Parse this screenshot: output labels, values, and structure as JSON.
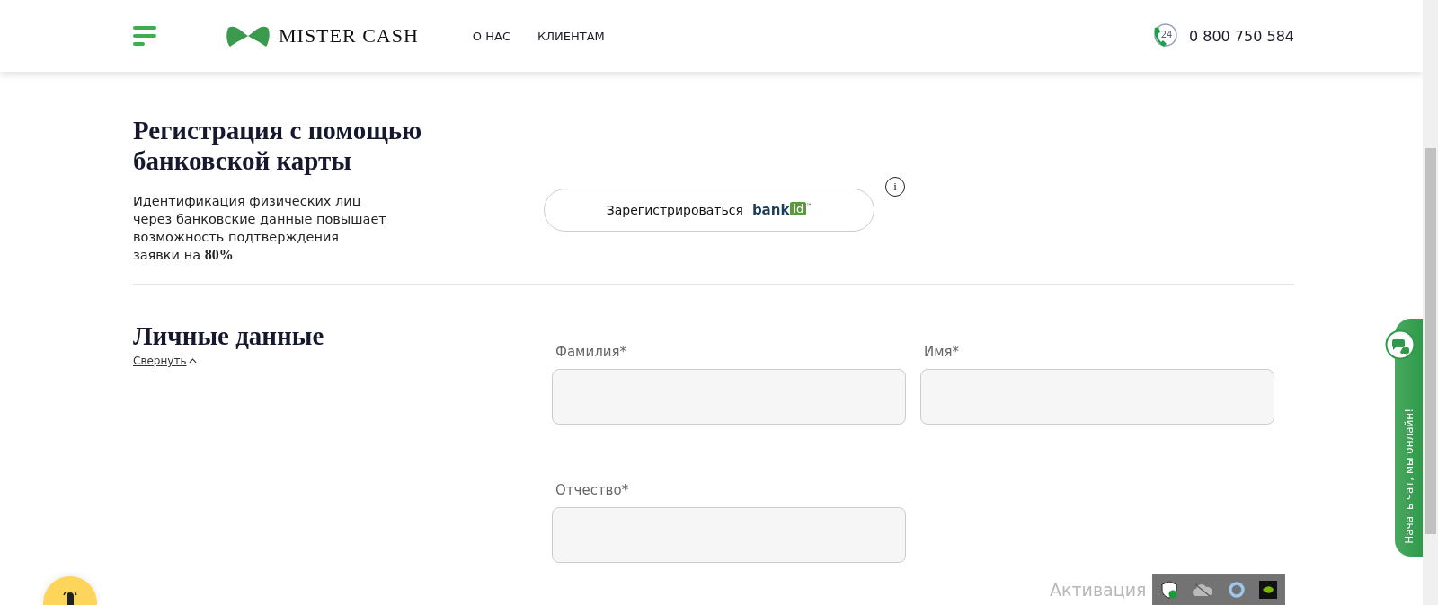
{
  "header": {
    "logo": "MISTER CASH",
    "nav": [
      {
        "label": "О НАС"
      },
      {
        "label": "КЛИЕНТАМ"
      }
    ],
    "phone": {
      "badge": "24",
      "number": "0 800 750 584"
    }
  },
  "bank_registration": {
    "title": "Регистрация с помощью банковской карты",
    "description": "Идентификация физических лиц через банковские данные повышает возможность подтверждения заявки на **80%**",
    "button": {
      "label": "Зарегистрироваться",
      "logo_text": "bank",
      "logo_badge": "id",
      "logo_mark": "™"
    },
    "info": "i"
  },
  "personal_data": {
    "title": "Личные данные",
    "collapse_link": "Свернуть",
    "fields": [
      {
        "label": "Фамилия*"
      },
      {
        "label": "Имя*"
      },
      {
        "label": "Отчество*"
      }
    ]
  },
  "chat_tab": {
    "label": "Начать чат, мы онлайн!"
  },
  "os_overlay": {
    "activation_text": "Активация"
  }
}
